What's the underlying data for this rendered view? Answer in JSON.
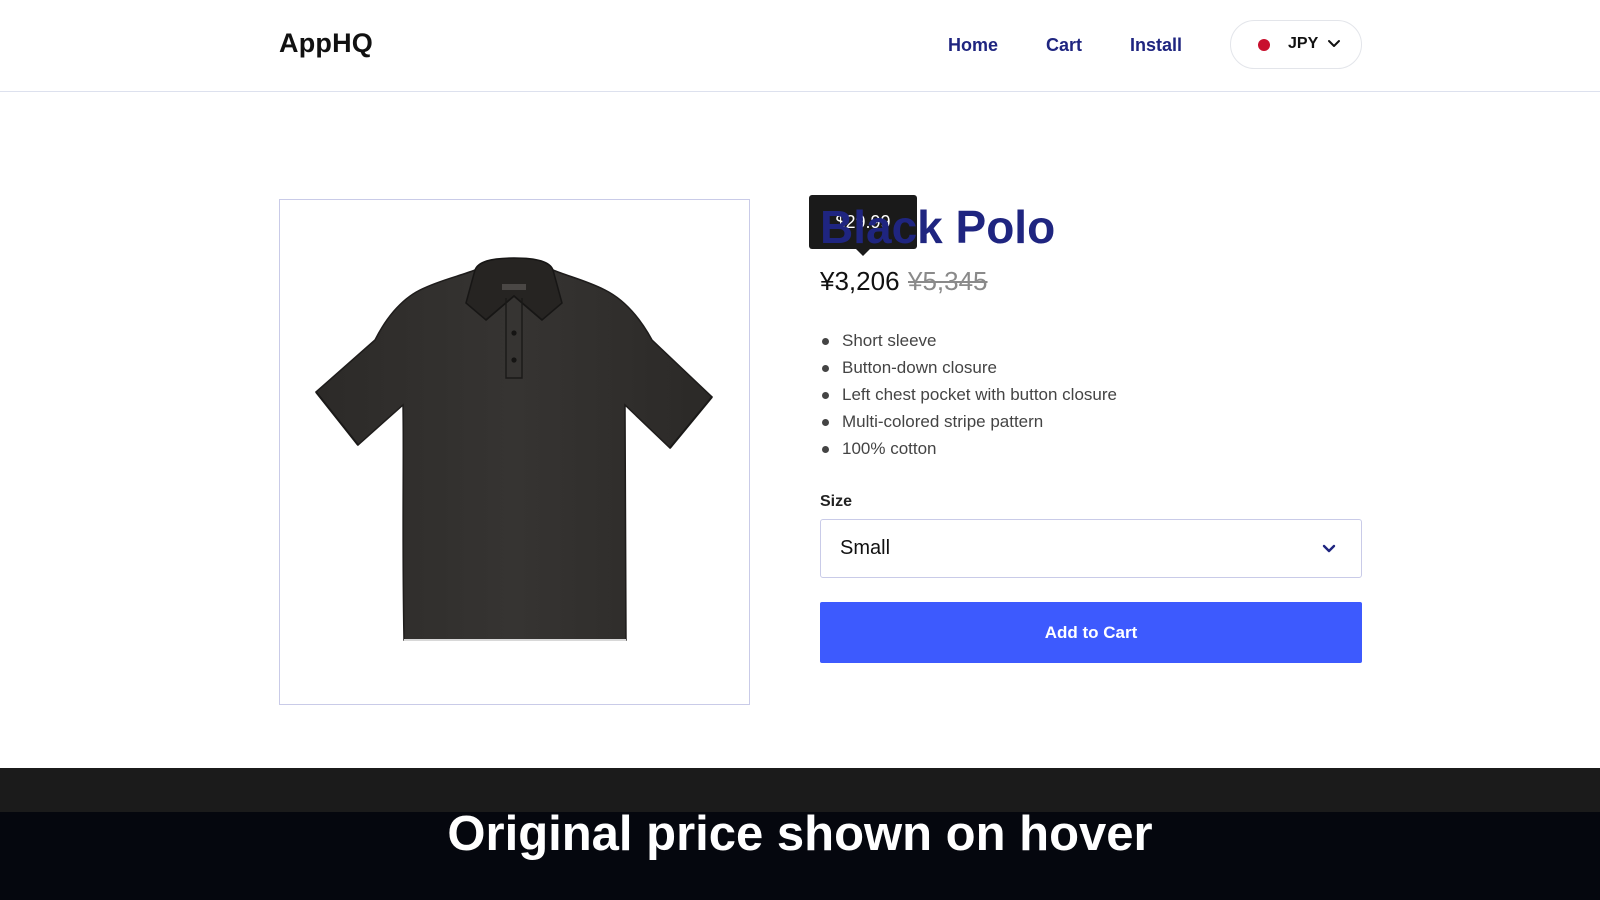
{
  "header": {
    "logo": "AppHQ",
    "nav": {
      "home": "Home",
      "cart": "Cart",
      "install": "Install"
    },
    "currency": {
      "code": "JPY",
      "flag_color": "#c8102e",
      "icon": "chevron-down-icon"
    }
  },
  "product": {
    "image_alt": "black-polo-shirt-image",
    "title": "Black Polo",
    "price_current": "¥3,206",
    "price_original": "¥5,345",
    "tooltip_price": "$29.99",
    "features": [
      "Short sleeve",
      "Button-down closure",
      "Left chest pocket with button closure",
      "Multi-colored stripe pattern",
      "100% cotton"
    ],
    "size_label": "Size",
    "size_selected": "Small",
    "add_to_cart": "Add to Cart"
  },
  "caption": "Original price shown on hover",
  "colors": {
    "accent": "#3d5afe",
    "brand_text": "#1f2580",
    "caption_bg": "#05070e"
  }
}
